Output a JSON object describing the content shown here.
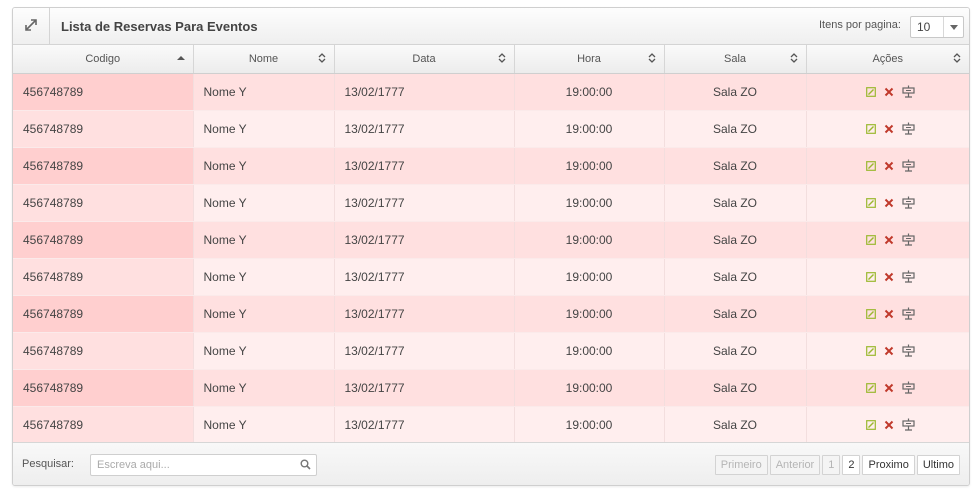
{
  "header": {
    "title": "Lista de Reservas Para Eventos",
    "per_page_label": "Itens por pagina:",
    "per_page_value": "10"
  },
  "columns": [
    "Codigo",
    "Nome",
    "Data",
    "Hora",
    "Sala",
    "Ações"
  ],
  "rows": [
    {
      "codigo": "456748789",
      "nome": "Nome Y",
      "data": "13/02/1777",
      "hora": "19:00:00",
      "sala": "Sala ZO"
    },
    {
      "codigo": "456748789",
      "nome": "Nome Y",
      "data": "13/02/1777",
      "hora": "19:00:00",
      "sala": "Sala ZO"
    },
    {
      "codigo": "456748789",
      "nome": "Nome Y",
      "data": "13/02/1777",
      "hora": "19:00:00",
      "sala": "Sala ZO"
    },
    {
      "codigo": "456748789",
      "nome": "Nome Y",
      "data": "13/02/1777",
      "hora": "19:00:00",
      "sala": "Sala ZO"
    },
    {
      "codigo": "456748789",
      "nome": "Nome Y",
      "data": "13/02/1777",
      "hora": "19:00:00",
      "sala": "Sala ZO"
    },
    {
      "codigo": "456748789",
      "nome": "Nome Y",
      "data": "13/02/1777",
      "hora": "19:00:00",
      "sala": "Sala ZO"
    },
    {
      "codigo": "456748789",
      "nome": "Nome Y",
      "data": "13/02/1777",
      "hora": "19:00:00",
      "sala": "Sala ZO"
    },
    {
      "codigo": "456748789",
      "nome": "Nome Y",
      "data": "13/02/1777",
      "hora": "19:00:00",
      "sala": "Sala ZO"
    },
    {
      "codigo": "456748789",
      "nome": "Nome Y",
      "data": "13/02/1777",
      "hora": "19:00:00",
      "sala": "Sala ZO"
    },
    {
      "codigo": "456748789",
      "nome": "Nome Y",
      "data": "13/02/1777",
      "hora": "19:00:00",
      "sala": "Sala ZO"
    }
  ],
  "row_actions": [
    "edit-icon",
    "delete-icon",
    "projector-icon"
  ],
  "footer": {
    "search_label": "Pesquisar:",
    "search_placeholder": "Escreva aqui...",
    "search_value": "",
    "pagination": {
      "first": "Primeiro",
      "previous": "Anterior",
      "pages": [
        "1",
        "2"
      ],
      "current_page": "1",
      "next": "Proximo",
      "last": "Ultimo"
    }
  },
  "colors": {
    "row_odd": "#ffe0e0",
    "row_even": "#ffeeee",
    "sorted_col_odd": "#ffcfcf",
    "edit_icon": "#9bb830",
    "delete_icon": "#c0392b"
  }
}
